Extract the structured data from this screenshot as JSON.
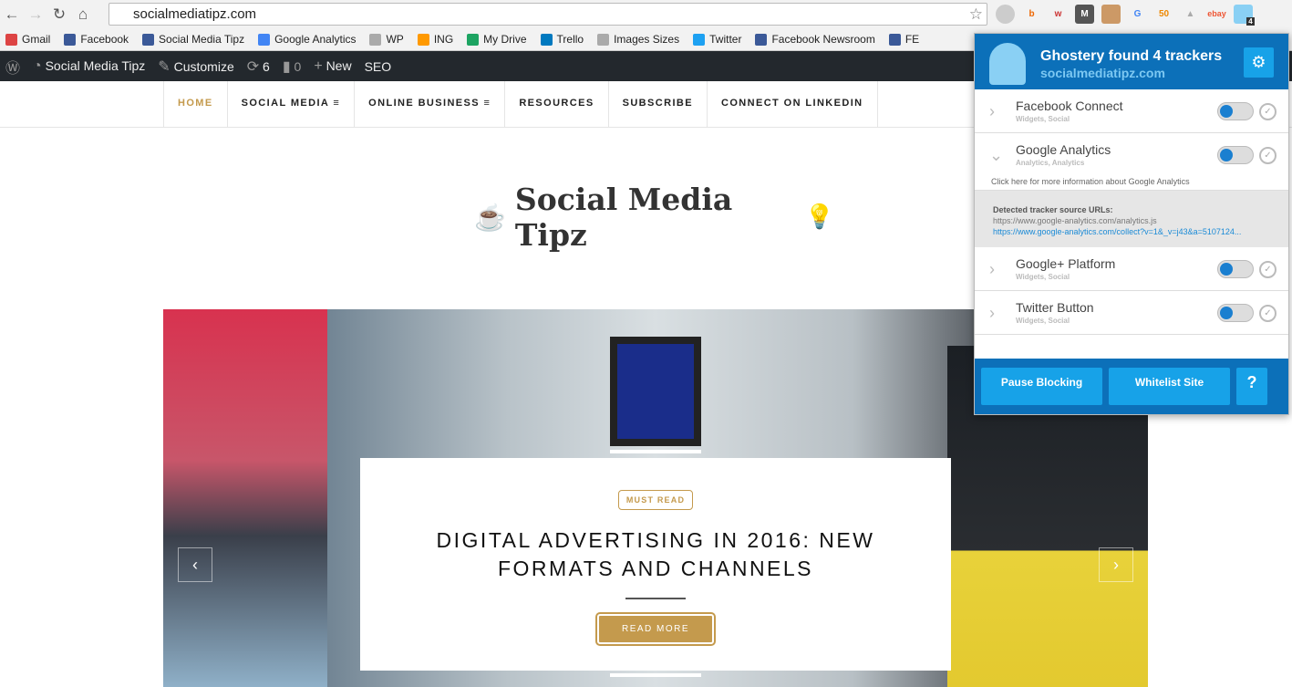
{
  "browser": {
    "url": "socialmediatipz.com",
    "ghostery_badge": "4"
  },
  "bookmarks": [
    {
      "label": "Gmail",
      "icon": "gmail-icon",
      "color": "#d44"
    },
    {
      "label": "Facebook",
      "icon": "facebook-icon",
      "color": "#3b5998"
    },
    {
      "label": "Social Media Tipz",
      "icon": "facebook-icon",
      "color": "#3b5998"
    },
    {
      "label": "Google Analytics",
      "icon": "google-icon",
      "color": "#4285f4"
    },
    {
      "label": "WP",
      "icon": "lightbulb-icon",
      "color": "#aaa"
    },
    {
      "label": "ING",
      "icon": "ing-icon",
      "color": "#f90"
    },
    {
      "label": "My Drive",
      "icon": "drive-icon",
      "color": "#1da462"
    },
    {
      "label": "Trello",
      "icon": "trello-icon",
      "color": "#0079bf"
    },
    {
      "label": "Images Sizes",
      "icon": "lightbulb-icon",
      "color": "#aaa"
    },
    {
      "label": "Twitter",
      "icon": "twitter-icon",
      "color": "#1da1f2"
    },
    {
      "label": "Facebook Newsroom",
      "icon": "facebook-icon",
      "color": "#3b5998"
    },
    {
      "label": "FE",
      "icon": "facebook-icon",
      "color": "#3b5998"
    }
  ],
  "wpbar": {
    "site": "Social Media Tipz",
    "customize": "Customize",
    "updates": "6",
    "comments": "0",
    "new": "New",
    "seo": "SEO"
  },
  "nav": [
    "HOME",
    "SOCIAL MEDIA",
    "ONLINE BUSINESS",
    "RESOURCES",
    "SUBSCRIBE",
    "CONNECT ON LINKEDIN"
  ],
  "logo": "Social Media Tipz",
  "hero": {
    "badge": "MUST READ",
    "title": "DIGITAL ADVERTISING IN 2016: NEW FORMATS AND CHANNELS",
    "read_more": "READ MORE"
  },
  "ghostery": {
    "title": "Ghostery found 4 trackers",
    "site": "socialmediatipz.com",
    "trackers": [
      {
        "name": "Facebook Connect",
        "category": "Widgets, Social"
      },
      {
        "name": "Google Analytics",
        "category": "Analytics, Analytics"
      },
      {
        "name": "Google+ Platform",
        "category": "Widgets, Social"
      },
      {
        "name": "Twitter Button",
        "category": "Widgets, Social"
      }
    ],
    "more_info": "Click here for more information about Google Analytics",
    "sources_label": "Detected tracker source URLs:",
    "sources": [
      "https://www.google-analytics.com/analytics.js",
      "https://www.google-analytics.com/collect?v=1&_v=j43&a=5107124..."
    ],
    "pause": "Pause Blocking",
    "whitelist": "Whitelist Site",
    "help": "?"
  }
}
